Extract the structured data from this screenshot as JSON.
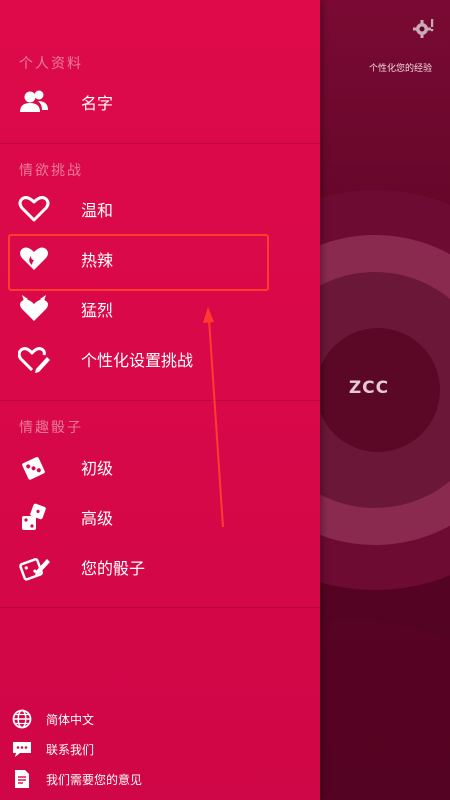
{
  "header": {
    "hint": "个性化您的经验"
  },
  "avatar": {
    "initials": "ZCC"
  },
  "profile": {
    "title": "个人资料",
    "items": [
      {
        "label": "名字",
        "icon": "users-icon"
      }
    ]
  },
  "challenges": {
    "title": "情欲挑战",
    "items": [
      {
        "label": "温和",
        "icon": "heart-outline-icon"
      },
      {
        "label": "热辣",
        "icon": "heart-flame-icon"
      },
      {
        "label": "猛烈",
        "icon": "heart-devil-icon"
      },
      {
        "label": "个性化设置挑战",
        "icon": "heart-edit-icon"
      }
    ]
  },
  "dice": {
    "title": "情趣骰子",
    "items": [
      {
        "label": "初级",
        "icon": "dice-icon"
      },
      {
        "label": "高级",
        "icon": "dice-stack-icon"
      },
      {
        "label": "您的骰子",
        "icon": "dice-edit-icon"
      }
    ]
  },
  "footer": {
    "items": [
      {
        "label": "简体中文",
        "icon": "globe-icon"
      },
      {
        "label": "联系我们",
        "icon": "chat-icon"
      },
      {
        "label": "我们需要您的意见",
        "icon": "feedback-icon"
      }
    ]
  },
  "colors": {
    "drawer": "#d80849",
    "background": "#5c0525",
    "highlight": "#ff3b2f"
  }
}
